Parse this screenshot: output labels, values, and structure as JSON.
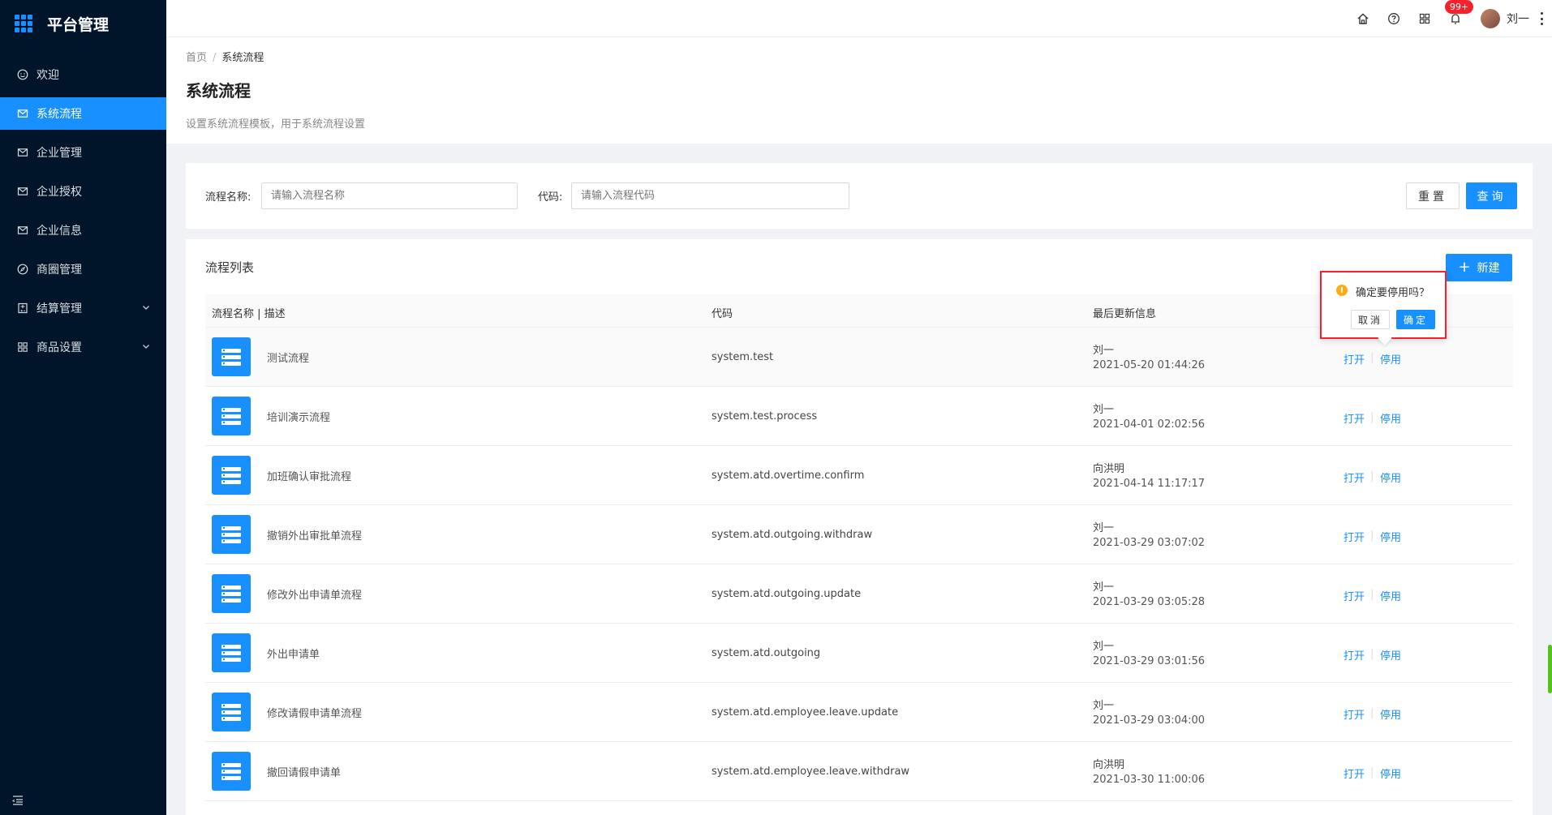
{
  "sidebar": {
    "brand": "平台管理",
    "items": [
      {
        "label": "欢迎",
        "icon": "smile-icon",
        "active": false,
        "has_arrow": false
      },
      {
        "label": "系统流程",
        "icon": "mail-icon",
        "active": true,
        "has_arrow": false
      },
      {
        "label": "企业管理",
        "icon": "mail-icon",
        "active": false,
        "has_arrow": false
      },
      {
        "label": "企业授权",
        "icon": "mail-icon",
        "active": false,
        "has_arrow": false
      },
      {
        "label": "企业信息",
        "icon": "mail-icon",
        "active": false,
        "has_arrow": false
      },
      {
        "label": "商圈管理",
        "icon": "compass-icon",
        "active": false,
        "has_arrow": false
      },
      {
        "label": "结算管理",
        "icon": "calculator-icon",
        "active": false,
        "has_arrow": true
      },
      {
        "label": "商品设置",
        "icon": "appstore-icon",
        "active": false,
        "has_arrow": true
      }
    ]
  },
  "header": {
    "icons": [
      "home-icon",
      "help-icon",
      "apps-icon",
      "bell-icon"
    ],
    "notification_badge": "99+",
    "username": "刘一"
  },
  "page": {
    "breadcrumb": [
      "首页",
      "系统流程"
    ],
    "breadcrumb_sep": "/",
    "title": "系统流程",
    "description": "设置系统流程模板，用于系统流程设置"
  },
  "filter": {
    "name_label": "流程名称:",
    "name_placeholder": "请输入流程名称",
    "code_label": "代码:",
    "code_placeholder": "请输入流程代码",
    "reset_label": "重置",
    "query_label": "查询"
  },
  "table": {
    "title": "流程列表",
    "new_label": "新建",
    "columns": [
      "流程名称 | 描述",
      "代码",
      "最后更新信息"
    ],
    "action_open": "打开",
    "action_stop": "停用",
    "action_sep": "|",
    "rows": [
      {
        "name": "测试流程",
        "code": "system.test",
        "user": "刘一",
        "time": "2021-05-20 01:44:26"
      },
      {
        "name": "培训演示流程",
        "code": "system.test.process",
        "user": "刘一",
        "time": "2021-04-01 02:02:56"
      },
      {
        "name": "加班确认审批流程",
        "code": "system.atd.overtime.confirm",
        "user": "向洪明",
        "time": "2021-04-14 11:17:17"
      },
      {
        "name": "撤销外出审批单流程",
        "code": "system.atd.outgoing.withdraw",
        "user": "刘一",
        "time": "2021-03-29 03:07:02"
      },
      {
        "name": "修改外出申请单流程",
        "code": "system.atd.outgoing.update",
        "user": "刘一",
        "time": "2021-03-29 03:05:28"
      },
      {
        "name": "外出申请单",
        "code": "system.atd.outgoing",
        "user": "刘一",
        "time": "2021-03-29 03:01:56"
      },
      {
        "name": "修改请假申请单流程",
        "code": "system.atd.employee.leave.update",
        "user": "刘一",
        "time": "2021-03-29 03:04:00"
      },
      {
        "name": "撤回请假申请单",
        "code": "system.atd.employee.leave.withdraw",
        "user": "向洪明",
        "time": "2021-03-30 11:00:06"
      }
    ]
  },
  "popconfirm": {
    "icon": "exclamation-circle-icon",
    "message": "确定要停用吗？",
    "cancel_label": "取消",
    "ok_label": "确定"
  },
  "colors": {
    "sidebar_bg": "#001529",
    "primary": "#1890ff",
    "highlight_border": "#f5222d",
    "warning": "#faad14"
  }
}
